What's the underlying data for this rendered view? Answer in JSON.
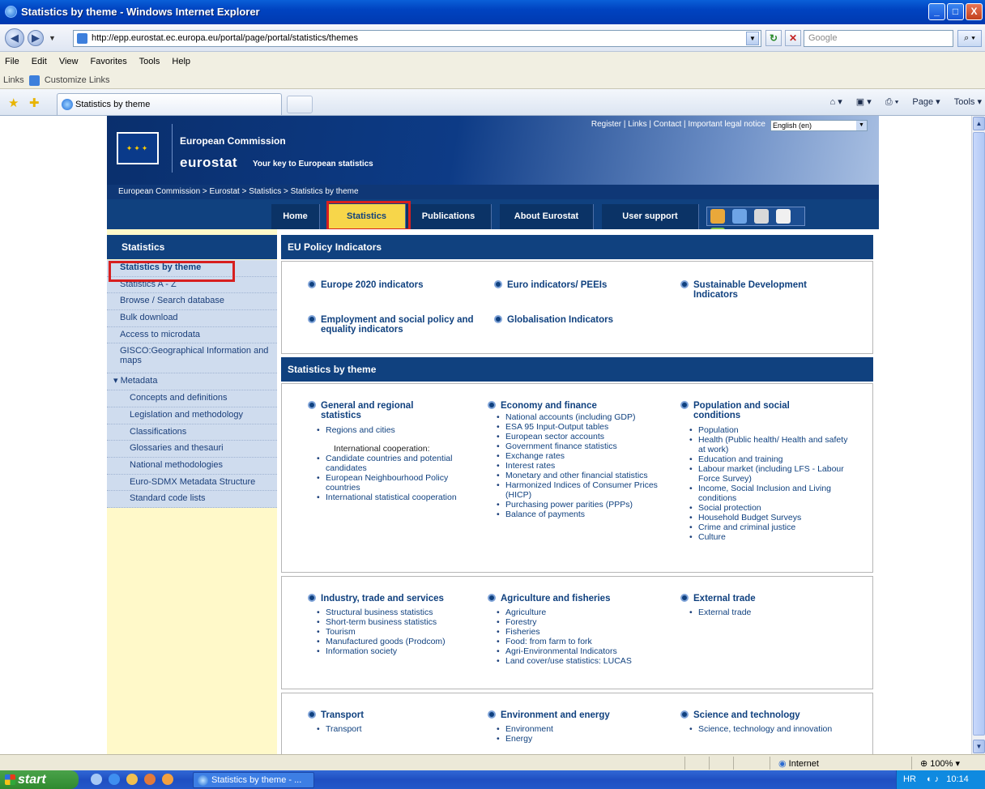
{
  "window": {
    "title": "Statistics by theme - Windows Internet Explorer",
    "min": "_",
    "max": "□",
    "close": "X"
  },
  "address": {
    "url": "http://epp.eurostat.ec.europa.eu/portal/page/portal/statistics/themes",
    "search_placeholder": "Google"
  },
  "menu": [
    "File",
    "Edit",
    "View",
    "Favorites",
    "Tools",
    "Help"
  ],
  "links_bar": {
    "label": "Links",
    "item": "Customize Links"
  },
  "tab": {
    "title": "Statistics by theme"
  },
  "command_bar": [
    "Page ▾",
    "Tools ▾"
  ],
  "site": {
    "top_links": "Register | Links | Contact | Important legal notice",
    "language": "English (en)",
    "ec_title": "European Commission",
    "eurostat": "eurostat",
    "tagline": "Your key to European statistics",
    "breadcrumb": "European Commission > Eurostat > Statistics > Statistics by theme",
    "nav": [
      {
        "label": "Home"
      },
      {
        "label": "Statistics"
      },
      {
        "label": "Publications"
      },
      {
        "label": "About Eurostat"
      },
      {
        "label": "User support"
      }
    ]
  },
  "sidebar": {
    "title": "Statistics",
    "items": [
      "Statistics by theme",
      "Statistics A - Z",
      "Browse / Search database",
      "Bulk download",
      "Access to microdata",
      "GISCO:Geographical Information and maps",
      "▾ Metadata",
      "Concepts and definitions",
      "Legislation and methodology",
      "Classifications",
      "Glossaries and thesauri",
      "National methodologies",
      "Euro-SDMX Metadata Structure",
      "Standard code lists"
    ]
  },
  "policy": {
    "title": "EU Policy Indicators",
    "links": [
      "Europe 2020 indicators",
      "Euro indicators/ PEEIs",
      "Sustainable Development Indicators",
      "Employment and social policy and equality indicators",
      "Globalisation Indicators"
    ]
  },
  "themes": {
    "title": "Statistics by theme",
    "general": {
      "title": "General and regional statistics",
      "items": [
        "Regions and cities"
      ],
      "intl_label": "International cooperation:",
      "intl_items": [
        "Candidate countries and potential candidates",
        "European Neighbourhood Policy countries",
        "International statistical cooperation"
      ]
    },
    "economy": {
      "title": "Economy and finance",
      "items": [
        "National accounts (including GDP)",
        "ESA 95 Input-Output tables",
        "European sector accounts",
        "Government finance statistics",
        "Exchange rates",
        "Interest rates",
        "Monetary and other financial statistics",
        "Harmonized Indices of Consumer Prices (HICP)",
        "Purchasing power parities (PPPs)",
        "Balance of payments"
      ]
    },
    "population": {
      "title": "Population and social conditions",
      "items": [
        "Population",
        "Health (Public health/ Health and safety at work)",
        "Education and training",
        "Labour market (including LFS - Labour Force Survey)",
        "Income, Social Inclusion and Living conditions",
        "Social protection",
        "Household Budget Surveys",
        "Crime and criminal justice",
        "Culture"
      ]
    },
    "industry": {
      "title": "Industry, trade and services",
      "items": [
        "Structural business statistics",
        "Short-term business statistics",
        "Tourism",
        "Manufactured goods (Prodcom)",
        "Information society"
      ]
    },
    "agriculture": {
      "title": "Agriculture and fisheries",
      "items": [
        "Agriculture",
        "Forestry",
        "Fisheries",
        "Food: from farm to fork",
        "Agri-Environmental Indicators",
        "Land cover/use statistics: LUCAS"
      ]
    },
    "external": {
      "title": "External trade",
      "items": [
        "External trade"
      ]
    },
    "transport": {
      "title": "Transport",
      "items": [
        "Transport"
      ]
    },
    "environment": {
      "title": "Environment and energy",
      "items": [
        "Environment",
        "Energy"
      ]
    },
    "science": {
      "title": "Science and technology",
      "items": [
        "Science, technology and innovation"
      ]
    }
  },
  "status": {
    "zone": "Internet",
    "zoom": "100%"
  },
  "taskbar": {
    "start": "start",
    "task": "Statistics by theme - ...",
    "lang": "HR",
    "clock": "10:14"
  }
}
